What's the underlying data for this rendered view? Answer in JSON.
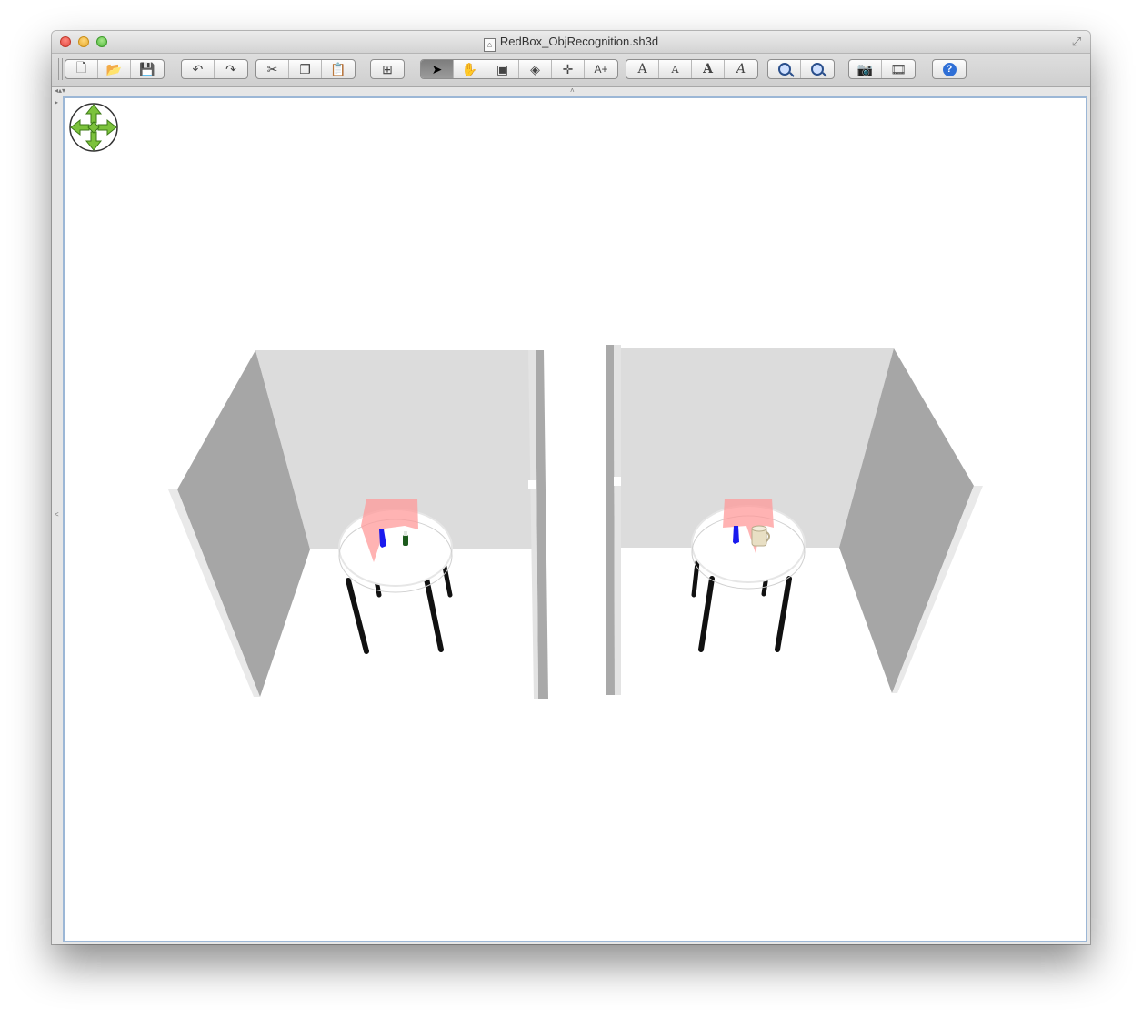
{
  "window": {
    "title": "RedBox_ObjRecognition.sh3d"
  },
  "toolbar": {
    "groups": [
      {
        "name": "file",
        "buttons": [
          {
            "id": "new-home",
            "icon": "new-document-icon",
            "glyph": "🗋"
          },
          {
            "id": "open",
            "icon": "open-folder-icon",
            "glyph": "📂"
          },
          {
            "id": "save",
            "icon": "save-icon",
            "glyph": "💾"
          }
        ]
      },
      {
        "name": "history",
        "buttons": [
          {
            "id": "undo",
            "icon": "undo-icon",
            "glyph": "↶"
          },
          {
            "id": "redo",
            "icon": "redo-icon",
            "glyph": "↷"
          }
        ]
      },
      {
        "name": "clipboard",
        "buttons": [
          {
            "id": "cut",
            "icon": "scissors-icon",
            "glyph": "✂"
          },
          {
            "id": "copy",
            "icon": "copy-icon",
            "glyph": "❐"
          },
          {
            "id": "paste",
            "icon": "paste-icon",
            "glyph": "📋"
          }
        ]
      },
      {
        "name": "furniture",
        "buttons": [
          {
            "id": "add-furniture",
            "icon": "add-furniture-icon",
            "glyph": "⊞"
          }
        ]
      },
      {
        "name": "modes",
        "buttons": [
          {
            "id": "select-mode",
            "icon": "arrow-pointer-icon",
            "glyph": "➤",
            "pressed": true
          },
          {
            "id": "pan-mode",
            "icon": "hand-icon",
            "glyph": "✋"
          },
          {
            "id": "create-walls",
            "icon": "create-walls-icon",
            "glyph": "▣"
          },
          {
            "id": "create-rooms",
            "icon": "create-rooms-icon",
            "glyph": "◈"
          },
          {
            "id": "create-dimensions",
            "icon": "create-dimensions-icon",
            "glyph": "✛"
          },
          {
            "id": "add-text",
            "icon": "add-text-icon",
            "glyph": "A+"
          }
        ]
      },
      {
        "name": "text-style",
        "buttons": [
          {
            "id": "increase-text",
            "icon": "increase-text-size-icon",
            "glyph": "A"
          },
          {
            "id": "decrease-text",
            "icon": "decrease-text-size-icon",
            "glyph": "A"
          },
          {
            "id": "bold-text",
            "icon": "bold-text-icon",
            "glyph": "A"
          },
          {
            "id": "italic-text",
            "icon": "italic-text-icon",
            "glyph": "A"
          }
        ]
      },
      {
        "name": "zoom",
        "buttons": [
          {
            "id": "zoom-in",
            "icon": "zoom-in-icon",
            "glyph": ""
          },
          {
            "id": "zoom-out",
            "icon": "zoom-out-icon",
            "glyph": ""
          }
        ]
      },
      {
        "name": "render",
        "buttons": [
          {
            "id": "create-photo",
            "icon": "camera-icon",
            "glyph": "📷"
          },
          {
            "id": "create-video",
            "icon": "video-icon",
            "glyph": "🎞"
          }
        ]
      },
      {
        "name": "help",
        "buttons": [
          {
            "id": "help",
            "icon": "help-icon",
            "glyph": "?"
          }
        ]
      }
    ]
  },
  "view3d": {
    "navigator_icon": "navigation-arrows-icon",
    "colors": {
      "wall_light": "#dcdcdc",
      "wall_dark": "#a6a6a6",
      "wall_edge": "#e9e9e9",
      "table_top": "#ffffff",
      "table_legs": "#111111",
      "red_box": "#ff9a9a",
      "blue_bottle": "#1a1aee",
      "green_bottle": "#1c5a1c",
      "mug": "#e8dfc4"
    }
  }
}
